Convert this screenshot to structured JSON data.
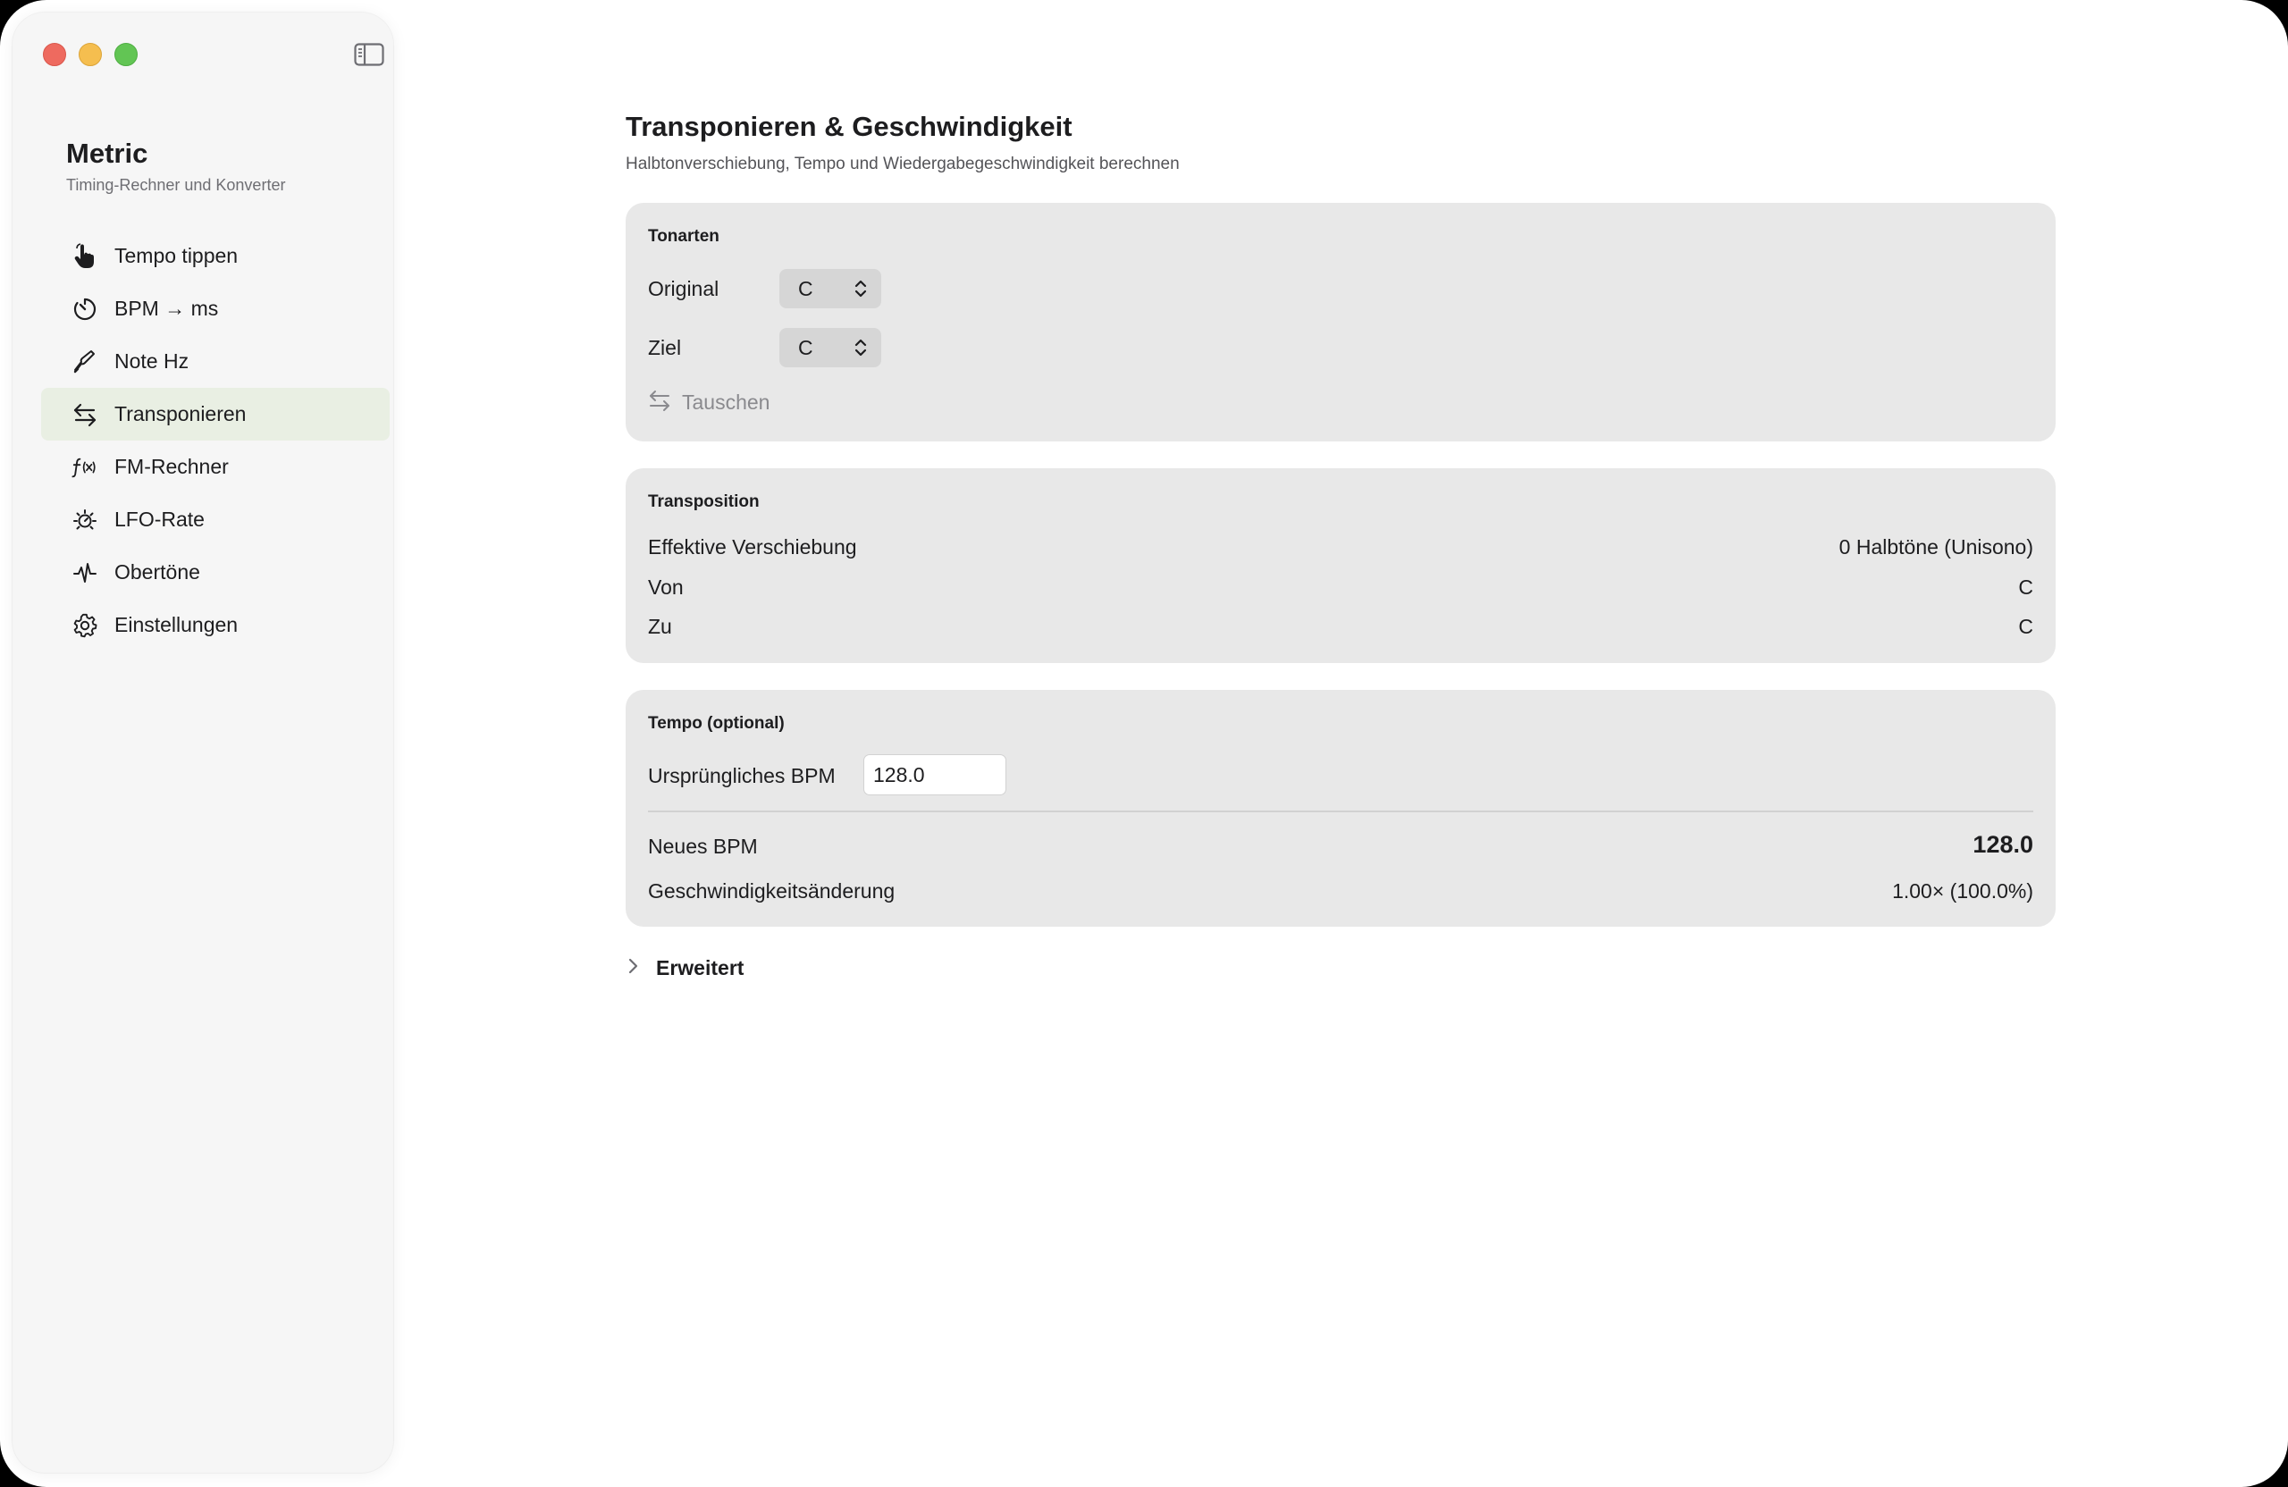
{
  "sidebar": {
    "app_title": "Metric",
    "app_subtitle": "Timing-Rechner und Konverter",
    "items": [
      {
        "label": "Tempo tippen",
        "icon": "tap-hand-icon",
        "active": false
      },
      {
        "label": "BPM → ms",
        "icon": "timer-icon",
        "active": false
      },
      {
        "label": "Note Hz",
        "icon": "tuning-fork-icon",
        "active": false
      },
      {
        "label": "Transponieren",
        "icon": "swap-arrows-icon",
        "active": true
      },
      {
        "label": "FM-Rechner",
        "icon": "function-icon",
        "active": false
      },
      {
        "label": "LFO-Rate",
        "icon": "sun-dial-icon",
        "active": false
      },
      {
        "label": "Obertöne",
        "icon": "waveform-icon",
        "active": false
      },
      {
        "label": "Einstellungen",
        "icon": "gear-icon",
        "active": false
      }
    ]
  },
  "main": {
    "title": "Transponieren & Geschwindigkeit",
    "subtitle": "Halbtonverschiebung, Tempo und Wiedergabegeschwindigkeit berechnen",
    "keys": {
      "title": "Tonarten",
      "original_label": "Original",
      "original_value": "C",
      "target_label": "Ziel",
      "target_value": "C",
      "swap_label": "Tauschen"
    },
    "transposition": {
      "title": "Transposition",
      "rows": [
        {
          "label": "Effektive Verschiebung",
          "value": "0 Halbtöne (Unisono)"
        },
        {
          "label": "Von",
          "value": "C"
        },
        {
          "label": "Zu",
          "value": "C"
        }
      ]
    },
    "tempo": {
      "title": "Tempo (optional)",
      "bpm_label": "Ursprüngliches BPM",
      "bpm_value": "128.0",
      "new_bpm_label": "Neues BPM",
      "new_bpm_value": "128.0",
      "speed_label": "Geschwindigkeitsänderung",
      "speed_value": "1.00× (100.0%)"
    },
    "advanced_label": "Erweitert"
  },
  "colors": {
    "active_item": "#e9efe3",
    "card": "#e8e8e8",
    "sidebar": "#f6f6f6"
  }
}
